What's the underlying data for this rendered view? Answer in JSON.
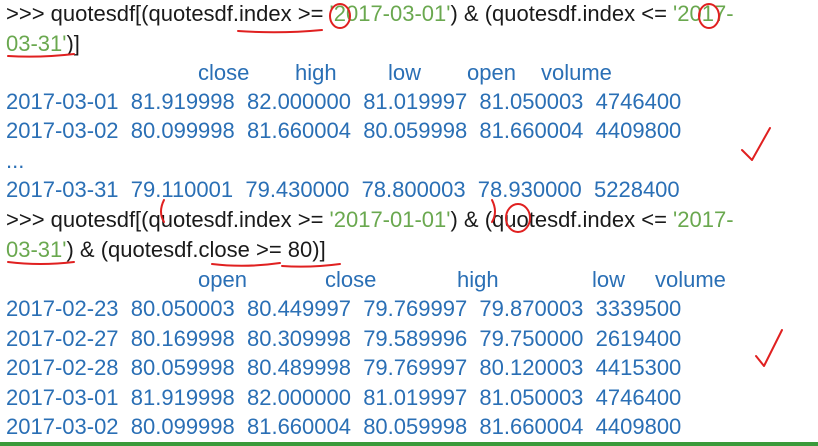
{
  "query1": {
    "prompt": ">>> ",
    "code_a": "quotesdf[(quotesdf.index >= ",
    "str_a": "'2017-03-01'",
    "code_b": ") & (quotesdf.index <= ",
    "str_b": "'2017-",
    "str_c": "03-31'",
    "code_c": ")]"
  },
  "table1": {
    "headers": [
      "close",
      "high",
      "low",
      "open",
      "volume"
    ],
    "rows": [
      "2017-03-01  81.919998  82.000000  81.019997  81.050003  4746400",
      "2017-03-02  80.099998  81.660004  80.059998  81.660004  4409800",
      "...",
      "2017-03-31  79.110001  79.430000  78.800003  78.930000  5228400"
    ]
  },
  "query2": {
    "prompt": ">>> ",
    "code_a": "quotesdf[(quotesdf.index >= ",
    "str_a": "'2017-01-01'",
    "code_b": ") & (quotesdf.index <= ",
    "str_b": "'2017-",
    "str_c": "03-31'",
    "code_c": ") & (quotesdf.close >= 80)]"
  },
  "table2": {
    "headers": [
      "open",
      "close",
      "high",
      "low",
      "volume"
    ],
    "rows": [
      "2017-02-23  80.050003  80.449997  79.769997  79.870003  3339500",
      "2017-02-27  80.169998  80.309998  79.589996  79.750000  2619400",
      "2017-02-28  80.059998  80.489998  79.769997  80.120003  4415300",
      "2017-03-01  81.919998  82.000000  81.019997  81.050003  4746400",
      "2017-03-02  80.099998  81.660004  80.059998  81.660004  4409800"
    ]
  },
  "colors": {
    "code": "#1a1a1a",
    "string": "#6aa84f",
    "output": "#2a6fb5",
    "annotation": "#e02020"
  }
}
